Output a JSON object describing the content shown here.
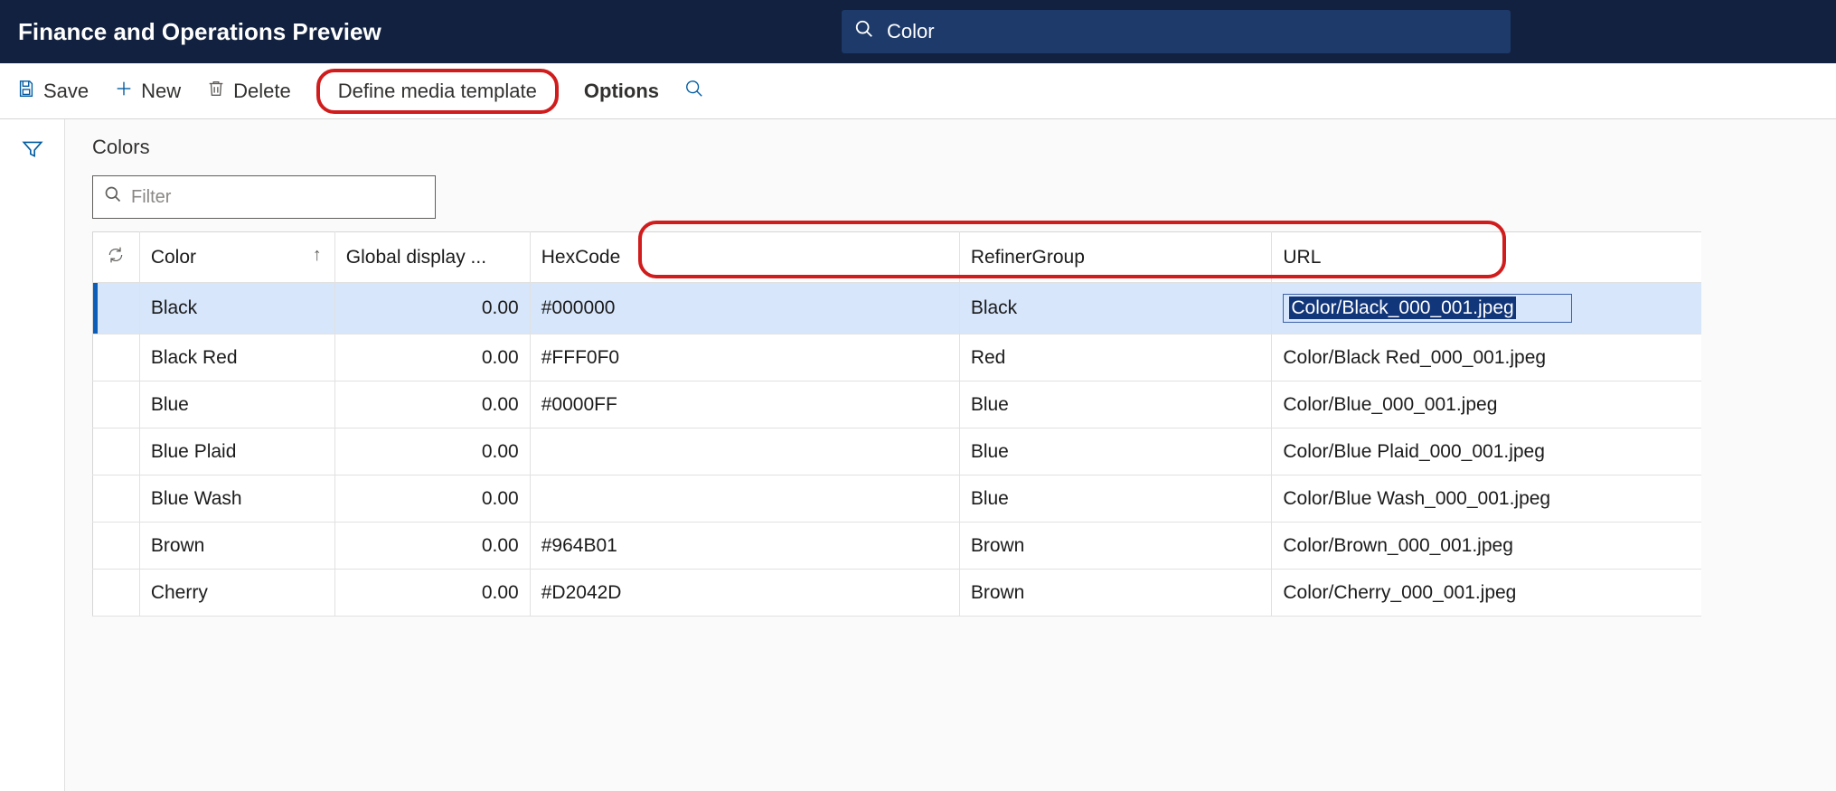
{
  "topbar": {
    "title": "Finance and Operations Preview",
    "search_value": "Color"
  },
  "actionbar": {
    "save": "Save",
    "new": "New",
    "delete": "Delete",
    "define_media_template": "Define media template",
    "options": "Options"
  },
  "page": {
    "title": "Colors",
    "filter_placeholder": "Filter"
  },
  "grid": {
    "columns": {
      "color": "Color",
      "global_display_order": "Global display ...",
      "hexcode": "HexCode",
      "refiner_group": "RefinerGroup",
      "url": "URL"
    },
    "rows": [
      {
        "color": "Black",
        "gdo": "0.00",
        "hex": "#000000",
        "refiner": "Black",
        "url": "Color/Black_000_001.jpeg",
        "selected": true,
        "editing_url": true
      },
      {
        "color": "Black Red",
        "gdo": "0.00",
        "hex": "#FFF0F0",
        "refiner": "Red",
        "url": "Color/Black Red_000_001.jpeg"
      },
      {
        "color": "Blue",
        "gdo": "0.00",
        "hex": "#0000FF",
        "refiner": "Blue",
        "url": "Color/Blue_000_001.jpeg"
      },
      {
        "color": "Blue Plaid",
        "gdo": "0.00",
        "hex": "",
        "refiner": "Blue",
        "url": "Color/Blue Plaid_000_001.jpeg"
      },
      {
        "color": "Blue Wash",
        "gdo": "0.00",
        "hex": "",
        "refiner": "Blue",
        "url": "Color/Blue Wash_000_001.jpeg"
      },
      {
        "color": "Brown",
        "gdo": "0.00",
        "hex": "#964B01",
        "refiner": "Brown",
        "url": "Color/Brown_000_001.jpeg"
      },
      {
        "color": "Cherry",
        "gdo": "0.00",
        "hex": "#D2042D",
        "refiner": "Brown",
        "url": "Color/Cherry_000_001.jpeg"
      }
    ]
  }
}
